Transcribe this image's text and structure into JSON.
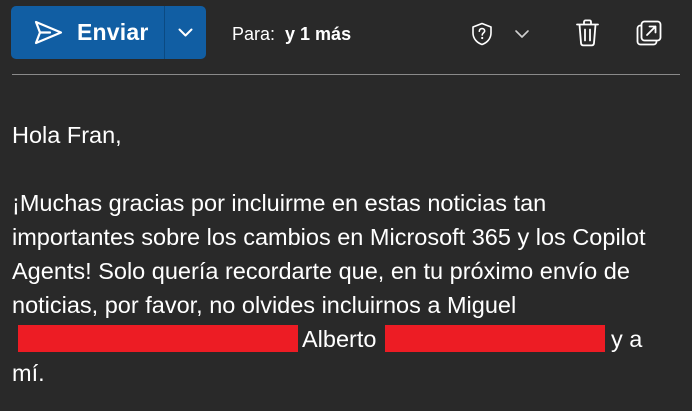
{
  "toolbar": {
    "send_label": "Enviar",
    "recipients_prefix": "Para:",
    "recipients_value": "y 1 más",
    "icons": {
      "send": "send-icon",
      "send_options": "chevron-down-icon",
      "sensitivity": "shield-question-icon",
      "sensitivity_menu": "chevron-down-icon",
      "discard": "trash-icon",
      "pop_out": "pop-out-icon"
    }
  },
  "message": {
    "greeting": "Hola Fran,",
    "body_before_redaction": "¡Muchas gracias por incluirme en estas noticias tan importantes sobre los cambios en Microsoft 365 y los Copilot Agents! Solo quería recordarte que, en tu próximo envío de noticias, por favor, no olvides incluirnos a Miguel",
    "name_middle": "Alberto",
    "body_after_redaction": "y a mí."
  },
  "colors": {
    "background": "#292929",
    "send_button": "#115ea3",
    "redaction": "#ed1c24",
    "divider": "#8a8a8a"
  }
}
